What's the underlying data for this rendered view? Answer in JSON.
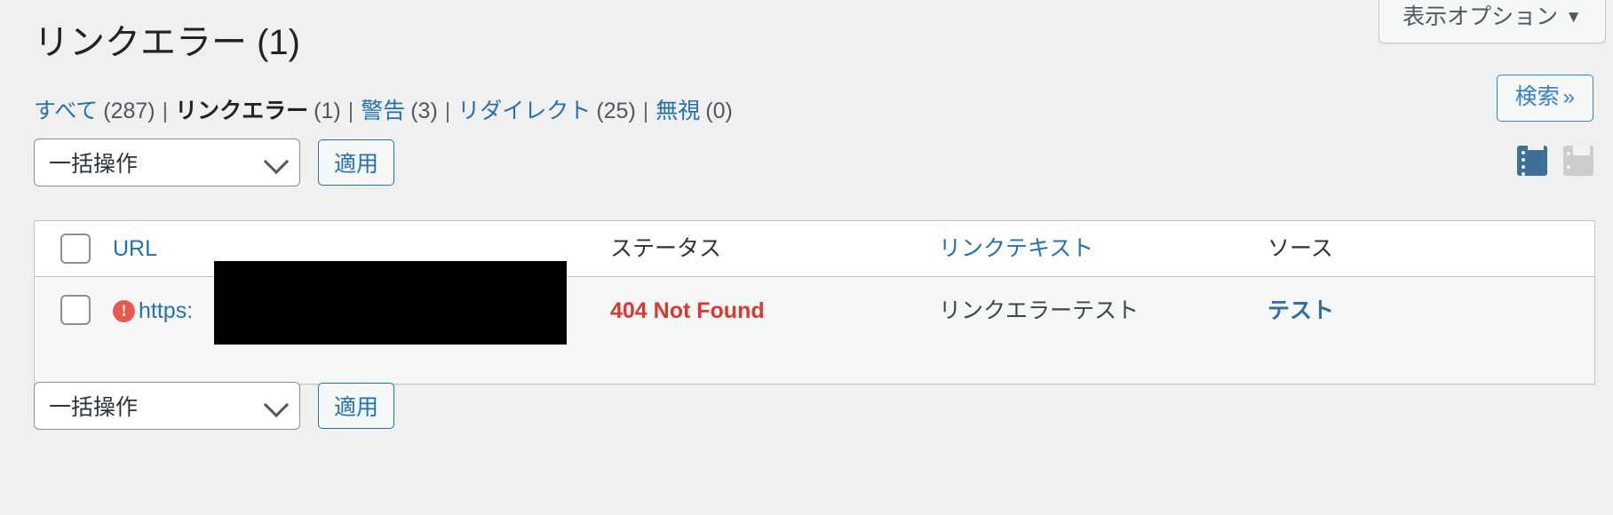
{
  "screen_options": {
    "label": "表示オプション",
    "caret": "▼"
  },
  "page_title": "リンクエラー (1)",
  "search_button": {
    "label": "検索",
    "chevron": "»"
  },
  "filters": {
    "separator": "|",
    "items": [
      {
        "label": "すべて",
        "count": "(287)",
        "current": false
      },
      {
        "label": "リンクエラー",
        "count": "(1)",
        "current": true
      },
      {
        "label": "警告",
        "count": "(3)",
        "current": false
      },
      {
        "label": "リダイレクト",
        "count": "(25)",
        "current": false
      },
      {
        "label": "無視",
        "count": "(0)",
        "current": false
      }
    ]
  },
  "toolbar_top": {
    "bulk_action_value": "一括操作",
    "apply_label": "適用"
  },
  "toolbar_bottom": {
    "bulk_action_value": "一括操作",
    "apply_label": "適用"
  },
  "view_switch": {
    "list_icon": "list-view-icon",
    "excerpt_icon": "excerpt-view-icon",
    "active": "list"
  },
  "table": {
    "columns": [
      {
        "label": "URL",
        "sortable": true
      },
      {
        "label": "ステータス",
        "sortable": false
      },
      {
        "label": "リンクテキスト",
        "sortable": true
      },
      {
        "label": "ソース",
        "sortable": false
      }
    ],
    "rows": [
      {
        "warn_icon": "error-exclamation-icon",
        "url": "https:",
        "redacted": true,
        "status": "404 Not Found",
        "link_text": "リンクエラーテスト",
        "source": "テスト"
      }
    ]
  },
  "colors": {
    "page_background": "#f0f0f1",
    "link": "#2271b1",
    "error_red": "#d9392e",
    "warn_icon": "#e8584d",
    "active_view_icon": "#3f6f96",
    "inactive_view_icon": "#cdcdcd",
    "row_background": "#f6f7f7",
    "border": "#c3c4c7"
  }
}
